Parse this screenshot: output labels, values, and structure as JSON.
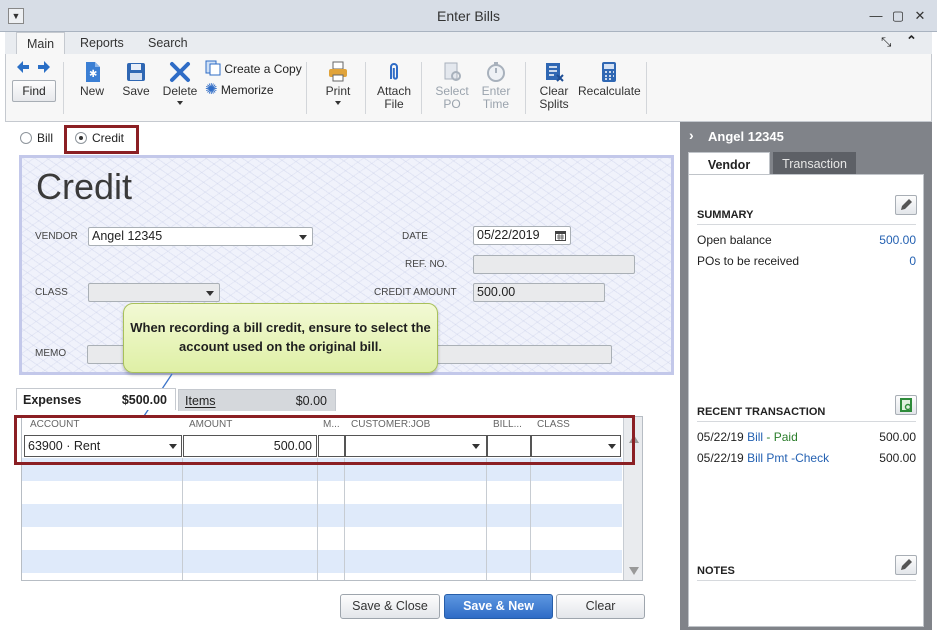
{
  "window": {
    "title": "Enter Bills"
  },
  "ribbon": {
    "tabs": [
      "Main",
      "Reports",
      "Search"
    ],
    "find": "Find",
    "new": "New",
    "save": "Save",
    "delete": "Delete",
    "create_copy": "Create a Copy",
    "memorize": "Memorize",
    "print": "Print",
    "attach_file": [
      "Attach",
      "File"
    ],
    "select_po": [
      "Select",
      "PO"
    ],
    "enter_time": [
      "Enter",
      "Time"
    ],
    "clear_splits": [
      "Clear",
      "Splits"
    ],
    "recalculate": "Recalculate"
  },
  "type_options": {
    "bill": "Bill",
    "credit": "Credit",
    "selected": "Credit"
  },
  "form": {
    "heading": "Credit",
    "vendor_label": "VENDOR",
    "vendor_value": "Angel 12345",
    "date_label": "DATE",
    "date_value": "05/22/2019",
    "ref_label": "REF. NO.",
    "ref_value": "",
    "class_label": "CLASS",
    "class_value": "",
    "credit_amount_label": "CREDIT AMOUNT",
    "credit_amount_value": "500.00",
    "memo_label": "MEMO",
    "memo_value": ""
  },
  "callout": {
    "text": "When recording a bill credit, ensure to select the account used on the original bill."
  },
  "tabs": {
    "expenses_label": "Expenses",
    "expenses_amount": "$500.00",
    "items_label": "Items",
    "items_amount": "$0.00"
  },
  "grid": {
    "headers": [
      "ACCOUNT",
      "AMOUNT",
      "M...",
      "CUSTOMER:JOB",
      "BILL...",
      "CLASS"
    ],
    "rows": [
      {
        "account": "63900 · Rent",
        "amount": "500.00",
        "memo": "",
        "customer_job": "",
        "billable": "",
        "class": ""
      }
    ]
  },
  "buttons": {
    "save_close": "Save & Close",
    "save_new": "Save & New",
    "clear": "Clear"
  },
  "sidebar": {
    "vendor_name": "Angel 12345",
    "tabs": [
      "Vendor",
      "Transaction"
    ],
    "summary_title": "SUMMARY",
    "summary": [
      {
        "label": "Open balance",
        "value": "500.00"
      },
      {
        "label": "POs to be received",
        "value": "0"
      }
    ],
    "recent_title": "RECENT TRANSACTION",
    "recent": [
      {
        "date": "05/22/19",
        "type": "Bill",
        "status": " - Paid",
        "amount": "500.00"
      },
      {
        "date": "05/22/19",
        "type": "Bill Pmt -Check",
        "status": "",
        "amount": "500.00"
      }
    ],
    "notes_title": "NOTES"
  },
  "colors": {
    "accent_red": "#8b1f23",
    "primary_blue": "#2f6cc6",
    "link_blue": "#2461b2"
  }
}
